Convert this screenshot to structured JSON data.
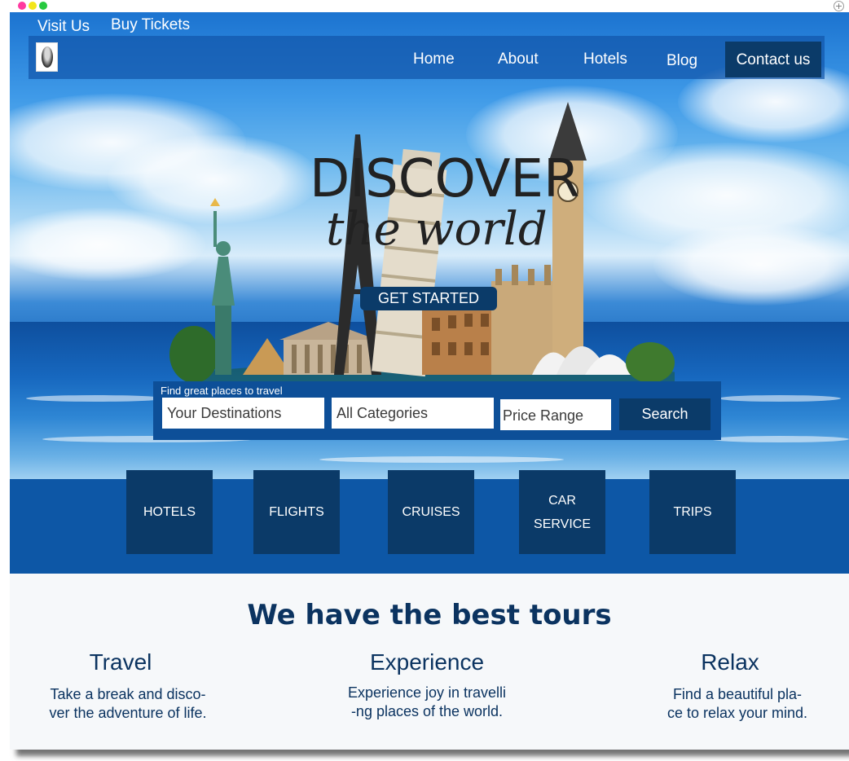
{
  "topbar": {
    "visit_label": "Visit Us",
    "tickets_label": "Buy Tickets"
  },
  "nav": {
    "home": "Home",
    "about": "About",
    "hotels": "Hotels",
    "blog": "Blog",
    "contact": "Contact us"
  },
  "hero": {
    "title": "DISCOVER",
    "subtitle": "the world",
    "cta": "GET STARTED"
  },
  "search": {
    "title": "Find great places to travel",
    "destinations": "Your Destinations",
    "categories": "All Categories",
    "price": "Price Range",
    "button": "Search"
  },
  "categories": [
    "HOTELS",
    "FLIGHTS",
    "CRUISES",
    "CAR SERVICE",
    "TRIPS"
  ],
  "tours": {
    "title": "We have the best tours",
    "columns": [
      {
        "title": "Travel",
        "line1": "Take a break and disco-",
        "line2": "ver the adventure of life."
      },
      {
        "title": "Experience",
        "line1": "Experience joy in travelli",
        "line2": "-ng places of the world."
      },
      {
        "title": "Relax",
        "line1": "Find a beautiful pla-",
        "line2": "ce to relax your mind."
      }
    ]
  },
  "colors": {
    "navy": "#0b3a68",
    "band": "#0d57a6",
    "accent": "#0b3360"
  }
}
